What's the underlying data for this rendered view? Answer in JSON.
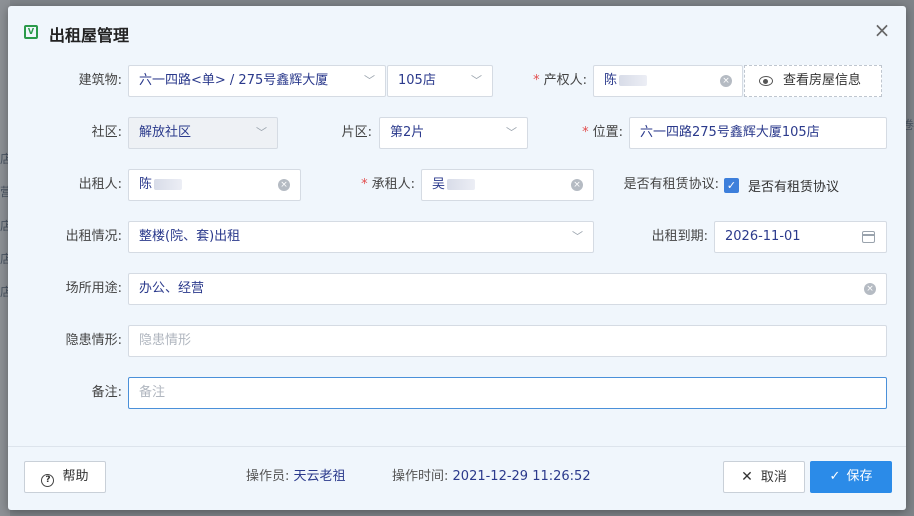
{
  "background": {
    "left_chars": [
      "店",
      "营",
      "店",
      "店",
      "店"
    ],
    "right_char": "卷"
  },
  "dialog": {
    "icon_glyph": "V",
    "title": "出租屋管理",
    "close_glyph": "×"
  },
  "form": {
    "building": {
      "label": "建筑物:",
      "value": "六一四路<单> / 275号鑫辉大厦",
      "sub_value": "105店"
    },
    "owner": {
      "label": "产权人:",
      "value": "陈"
    },
    "view_house_button": "查看房屋信息",
    "community": {
      "label": "社区:",
      "value": "解放社区"
    },
    "area": {
      "label": "片区:",
      "value": "第2片"
    },
    "location": {
      "label": "位置:",
      "value": "六一四路275号鑫辉大厦105店"
    },
    "lessor": {
      "label": "出租人:",
      "value": "陈"
    },
    "tenant": {
      "label": "承租人:",
      "value": "吴"
    },
    "lease_agreement": {
      "label": "是否有租赁协议:",
      "checkbox_text": "是否有租赁协议",
      "checked": true
    },
    "rental_status": {
      "label": "出租情况:",
      "value": "整楼(院、套)出租"
    },
    "rental_expiry": {
      "label": "出租到期:",
      "value": "2026-11-01"
    },
    "usage": {
      "label": "场所用途:",
      "value": "办公、经营"
    },
    "hazard": {
      "label": "隐患情形:",
      "placeholder": "隐患情形"
    },
    "remarks": {
      "label": "备注:",
      "placeholder": "备注"
    }
  },
  "footer": {
    "help_label": "帮助",
    "operator_label": "操作员:",
    "operator_value": "天云老祖",
    "op_time_label": "操作时间:",
    "op_time_value": "2021-12-29 11:26:52",
    "cancel_label": "取消",
    "save_label": "保存"
  },
  "colors": {
    "accent": "#2b8be8",
    "required": "#e24c4c",
    "value_text": "#2b3a8c"
  }
}
